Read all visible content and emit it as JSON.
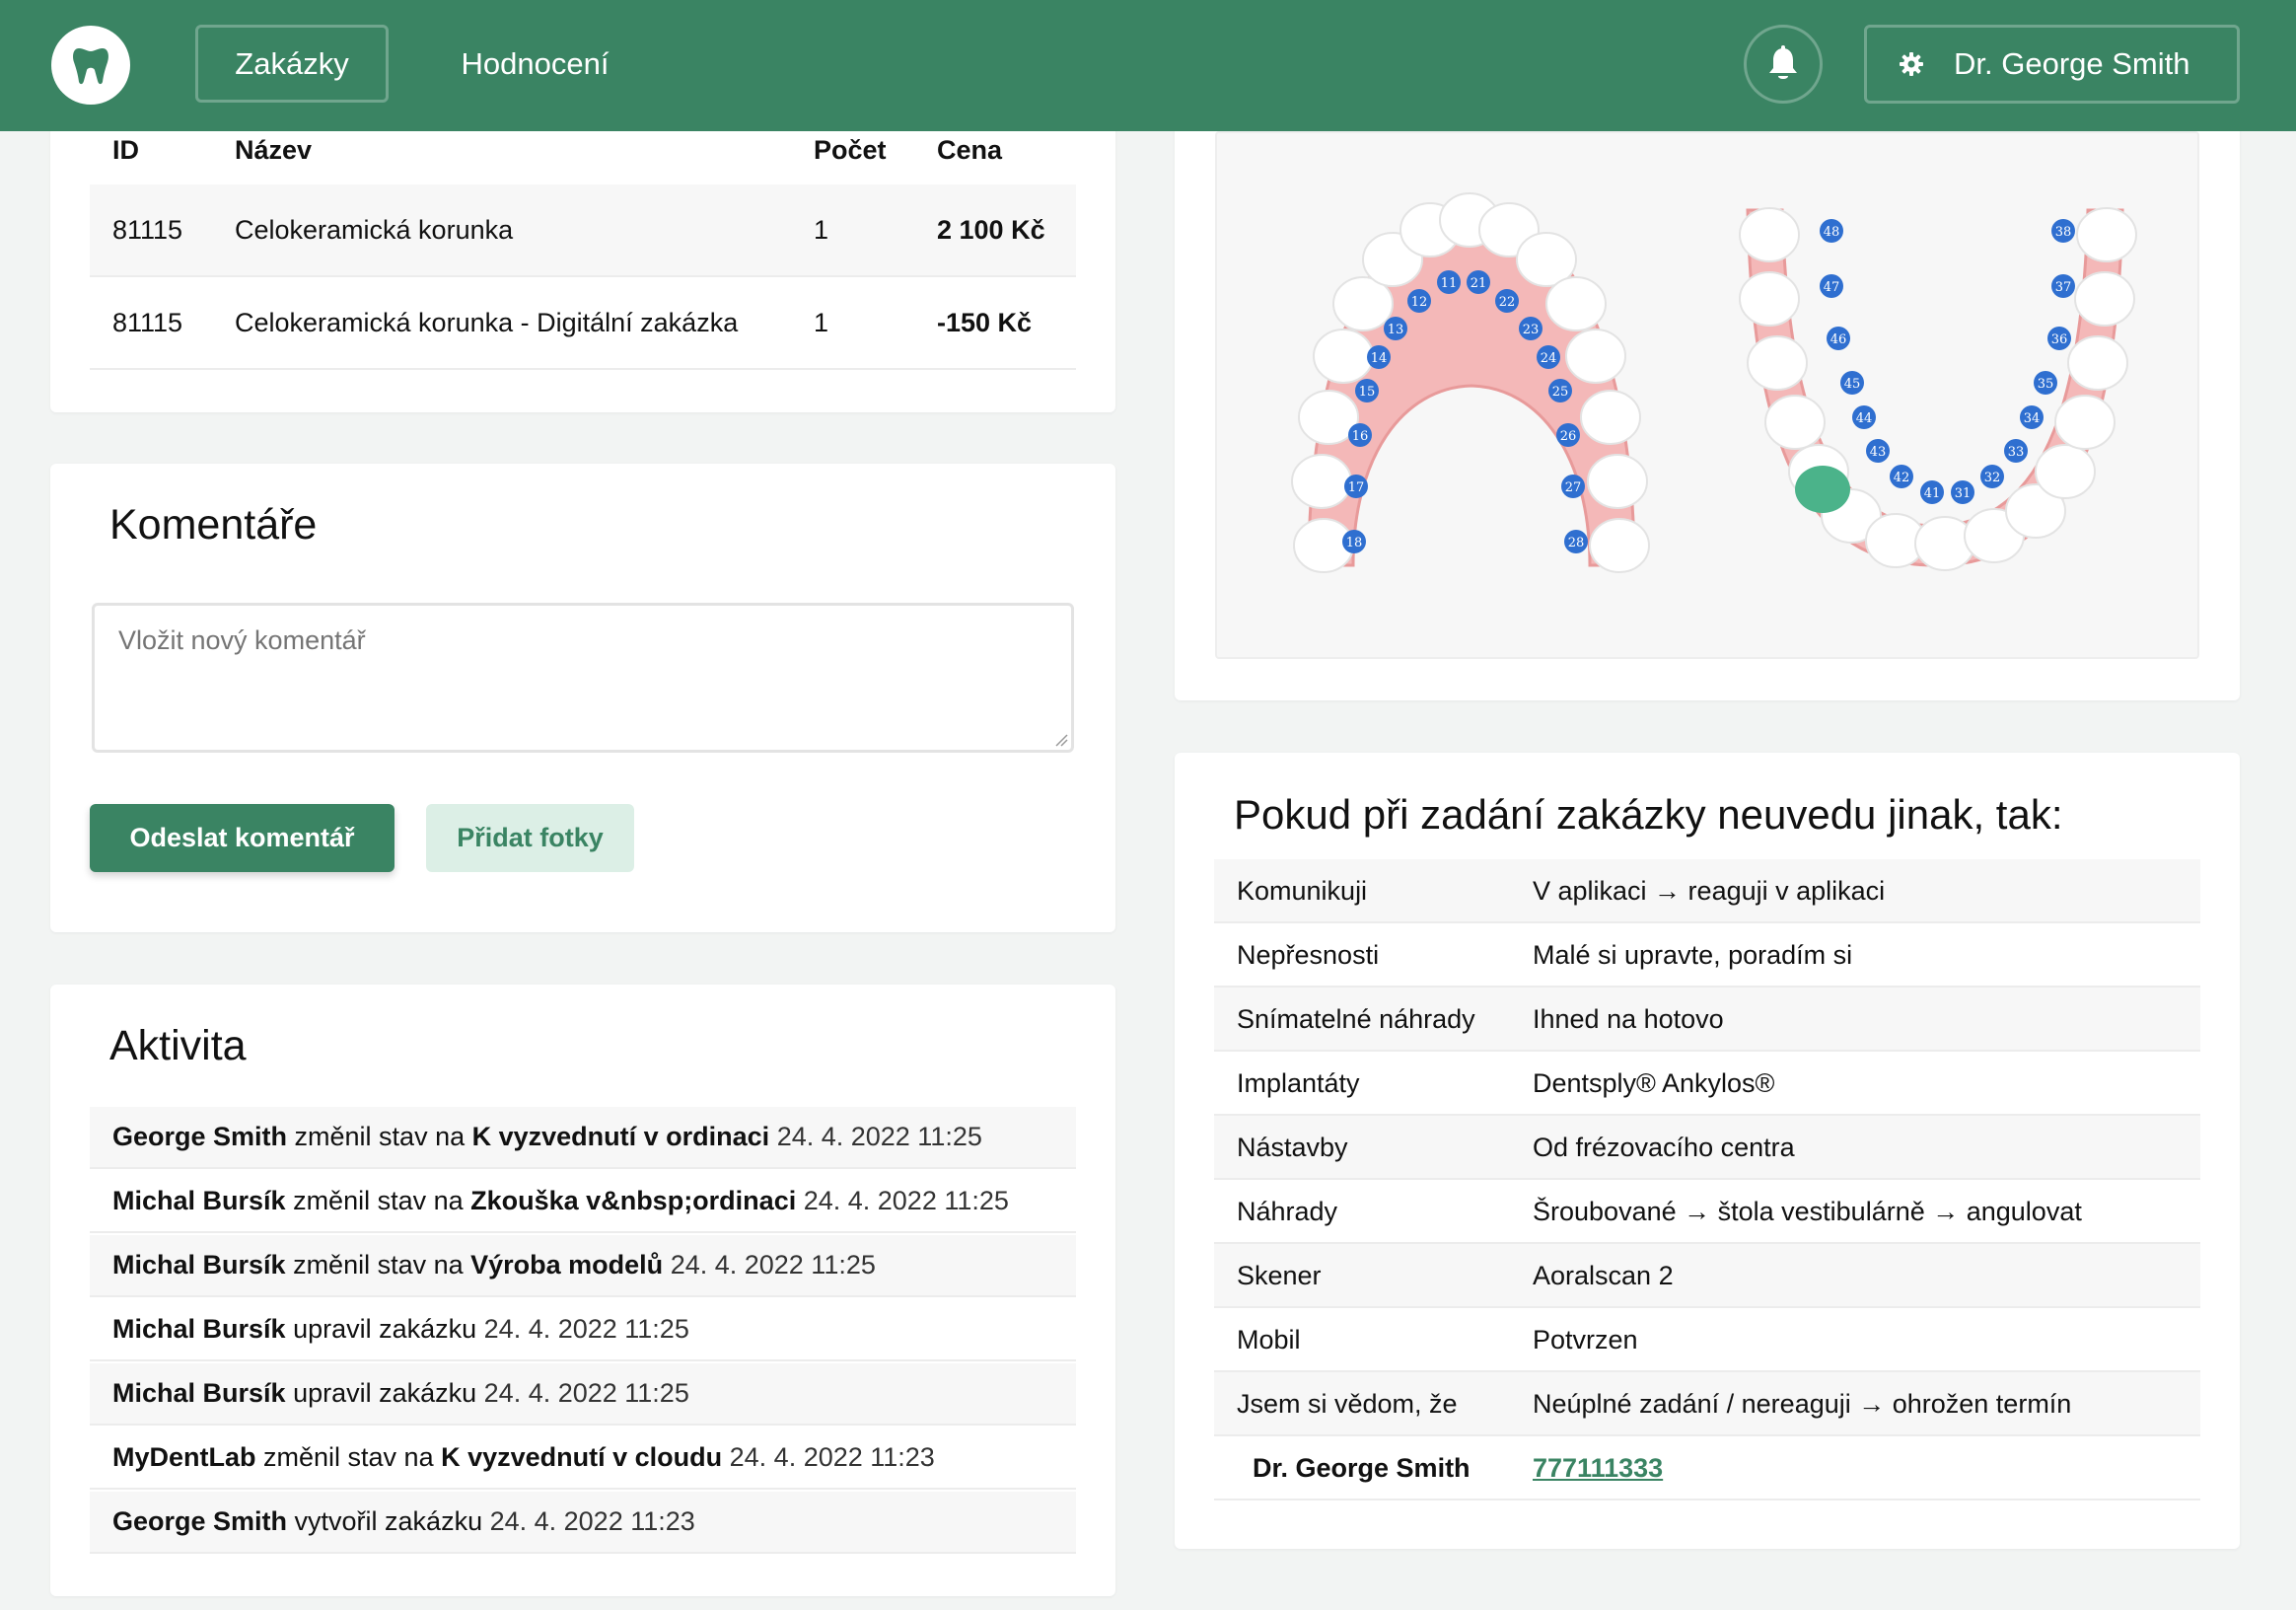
{
  "nav": {
    "orders": "Zakázky",
    "reviews": "Hodnocení",
    "user": "Dr. George Smith"
  },
  "items_table": {
    "headers": {
      "id": "ID",
      "name": "Název",
      "count": "Počet",
      "price": "Cena"
    },
    "rows": [
      {
        "id": "81115",
        "name": "Celokeramická korunka",
        "count": "1",
        "price": "2 100 Kč"
      },
      {
        "id": "81115",
        "name": "Celokeramická korunka - Digitální zakázka",
        "count": "1",
        "price": "-150 Kč"
      }
    ]
  },
  "comments": {
    "title": "Komentáře",
    "placeholder": "Vložit nový komentář",
    "submit_label": "Odeslat komentář",
    "photos_label": "Přidat fotky"
  },
  "activity": {
    "title": "Aktivita",
    "items": [
      {
        "who": "George Smith",
        "action": " změnil stav na ",
        "target": "K vyzvednutí v ordinaci",
        "time": " 24. 4. 2022 11:25"
      },
      {
        "who": "Michal Bursík",
        "action": " změnil stav na ",
        "target": "Zkouška v&nbsp;ordinaci",
        "time": " 24. 4. 2022 11:25"
      },
      {
        "who": "Michal Bursík",
        "action": " změnil stav na ",
        "target": "Výroba modelů",
        "time": " 24. 4. 2022 11:25"
      },
      {
        "who": "Michal Bursík",
        "action": " upravil zakázku",
        "target": "",
        "time": " 24. 4. 2022 11:25"
      },
      {
        "who": "Michal Bursík",
        "action": " upravil zakázku",
        "target": "",
        "time": " 24. 4. 2022 11:25"
      },
      {
        "who": "MyDentLab",
        "action": " změnil stav na ",
        "target": "K vyzvednutí v cloudu",
        "time": " 24. 4. 2022 11:23"
      },
      {
        "who": "George Smith",
        "action": " vytvořil zakázku",
        "target": "",
        "time": " 24. 4. 2022 11:23"
      }
    ]
  },
  "teeth": {
    "upper_left": [
      "11",
      "12",
      "13",
      "14",
      "15",
      "16",
      "17",
      "18"
    ],
    "upper_right": [
      "21",
      "22",
      "23",
      "24",
      "25",
      "26",
      "27",
      "28"
    ],
    "lower_left": [
      "48",
      "47",
      "46",
      "45",
      "44",
      "43",
      "42",
      "41"
    ],
    "lower_right": [
      "38",
      "37",
      "36",
      "35",
      "34",
      "33",
      "32",
      "31"
    ],
    "selected": [
      "43"
    ],
    "colors": {
      "gum": "#f4b8b8",
      "gum_edge": "#e89a9a",
      "marker": "#2f6fd0",
      "selected": "#4bb38a"
    }
  },
  "preferences": {
    "title": "Pokud při zadání zakázky neuvedu jinak, tak:",
    "rows": [
      {
        "k": "Komunikuji",
        "v": "V aplikaci → reaguji v aplikaci"
      },
      {
        "k": "Nepřesnosti",
        "v": "Malé si upravte, poradím si"
      },
      {
        "k": "Snímatelné náhrady",
        "v": "Ihned na hotovo"
      },
      {
        "k": "Implantáty",
        "v": "Dentsply® Ankylos®"
      },
      {
        "k": "Nástavby",
        "v": "Od frézovacího centra"
      },
      {
        "k": "Náhrady",
        "v": "Šroubované → štola vestibulárně → angulovat"
      },
      {
        "k": "Skener",
        "v": "Aoralscan 2"
      },
      {
        "k": "Mobil",
        "v": "Potvrzen"
      },
      {
        "k": "Jsem si vědom, že",
        "v": "Neúplné zadání / nereaguji → ohrožen termín"
      }
    ],
    "contact_name": "Dr. George Smith",
    "contact_phone": "777111333"
  }
}
